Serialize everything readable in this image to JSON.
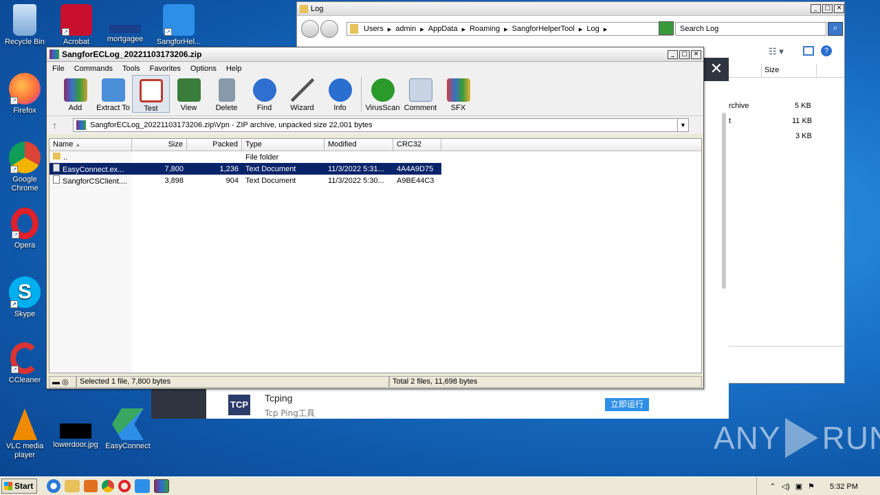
{
  "desktop": {
    "icons": [
      {
        "label": "Recycle Bin",
        "icon": "recycle-bin-icon",
        "color": "#9cc3e8"
      },
      {
        "label": "Acrobat",
        "icon": "acrobat-icon",
        "color": "#c8102e"
      },
      {
        "label": "mortgagee",
        "icon": "file-icon",
        "color": "#1a3f8c"
      },
      {
        "label": "SangforHel...",
        "icon": "sangfor-icon",
        "color": "#2d8fe8"
      },
      {
        "label": "Firefox",
        "icon": "firefox-icon",
        "color": "#ff7139"
      },
      {
        "label": "Google Chrome",
        "icon": "chrome-icon",
        "color": "#4caf50"
      },
      {
        "label": "Opera",
        "icon": "opera-icon",
        "color": "#e0202a"
      },
      {
        "label": "Skype",
        "icon": "skype-icon",
        "color": "#00aff0"
      },
      {
        "label": "CCleaner",
        "icon": "ccleaner-icon",
        "color": "#d33"
      },
      {
        "label": "VLC media player",
        "icon": "vlc-icon",
        "color": "#f08a00"
      },
      {
        "label": "lowerdoor.jpg",
        "icon": "image-file-icon",
        "color": "#000000"
      },
      {
        "label": "EasyConnect",
        "icon": "easyconnect-icon",
        "color": "#3aa860"
      }
    ],
    "watermark": "ANY RUN"
  },
  "explorer": {
    "title": "Log",
    "breadcrumb": [
      "Users",
      "admin",
      "AppData",
      "Roaming",
      "SangforHelperTool",
      "Log"
    ],
    "search_placeholder": "Search Log",
    "column_size": "Size",
    "rows": [
      {
        "name": "rchive",
        "size": "5 KB"
      },
      {
        "name": "t",
        "size": "11 KB"
      },
      {
        "name": "",
        "size": "3 KB"
      }
    ]
  },
  "ad": {
    "logo": "TCP",
    "title": "Tcping",
    "subtitle": "Tcp Ping工具",
    "button": "立即运行",
    "close": "✕"
  },
  "winrar": {
    "title": "SangforECLog_20221103173206.zip",
    "menu": [
      "File",
      "Commands",
      "Tools",
      "Favorites",
      "Options",
      "Help"
    ],
    "tools": [
      {
        "label": "Add",
        "icon": "add-icon",
        "color": "#8a6d3b"
      },
      {
        "label": "Extract To",
        "icon": "extract-icon",
        "color": "#4a8fd8"
      },
      {
        "label": "Test",
        "icon": "test-icon",
        "color": "#c0392b"
      },
      {
        "label": "View",
        "icon": "view-icon",
        "color": "#3a7d3a"
      },
      {
        "label": "Delete",
        "icon": "delete-icon",
        "color": "#8899aa"
      },
      {
        "label": "Find",
        "icon": "find-icon",
        "color": "#2f6fcf"
      },
      {
        "label": "Wizard",
        "icon": "wizard-icon",
        "color": "#5a9"
      },
      {
        "label": "Info",
        "icon": "info-icon",
        "color": "#2a6fd0"
      },
      {
        "label": "VirusScan",
        "icon": "virusscan-icon",
        "color": "#2a9a2a"
      },
      {
        "label": "Comment",
        "icon": "comment-icon",
        "color": "#7a8fb0"
      },
      {
        "label": "SFX",
        "icon": "sfx-icon",
        "color": "#d04040"
      }
    ],
    "path": "SangforECLog_20221103173206.zip\\Vpn - ZIP archive, unpacked size 22,001 bytes",
    "columns": [
      "Name",
      "Size",
      "Packed",
      "Type",
      "Modified",
      "CRC32"
    ],
    "files": [
      {
        "name": "..",
        "size": "",
        "packed": "",
        "type": "File folder",
        "modified": "",
        "crc": ""
      },
      {
        "name": "EasyConnect.ex...",
        "size": "7,800",
        "packed": "1,236",
        "type": "Text Document",
        "modified": "11/3/2022 5:31...",
        "crc": "4A4A9D75"
      },
      {
        "name": "SangforCSClient....",
        "size": "3,898",
        "packed": "904",
        "type": "Text Document",
        "modified": "11/3/2022 5:30...",
        "crc": "A9BE44C3"
      }
    ],
    "status_left": "Selected 1 file, 7,800 bytes",
    "status_right": "Total 2 files, 11,698 bytes"
  },
  "taskbar": {
    "start": "Start",
    "apps": [
      {
        "icon": "ie-icon",
        "color": "#2a7ad8"
      },
      {
        "icon": "explorer-icon",
        "color": "#e8c15a"
      },
      {
        "icon": "media-icon",
        "color": "#e07020"
      },
      {
        "icon": "chrome-icon",
        "color": "#4caf50"
      },
      {
        "icon": "opera-icon",
        "color": "#e0202a"
      },
      {
        "icon": "sangfor-icon",
        "color": "#2d8fe8"
      },
      {
        "icon": "winrar-icon",
        "color": "#8a2a6a"
      }
    ],
    "clock": "5:32 PM"
  }
}
